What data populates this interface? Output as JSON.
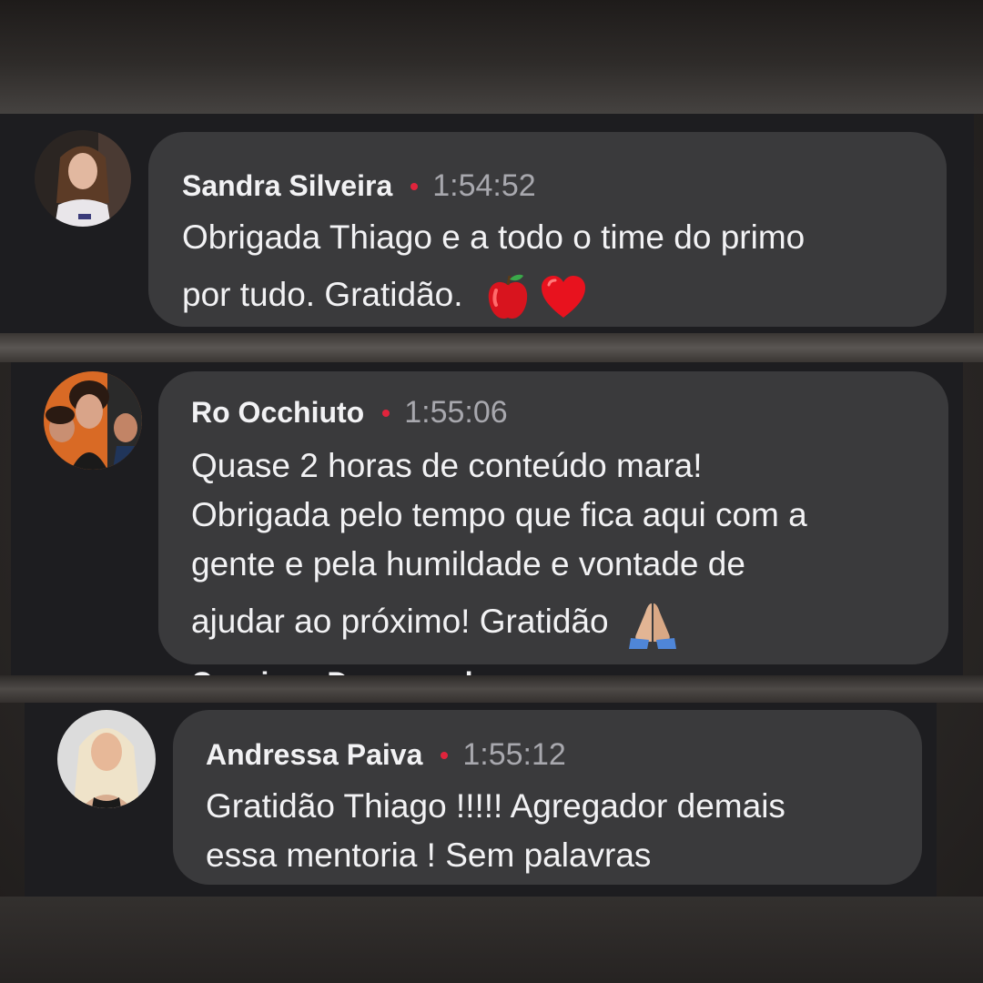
{
  "theme": {
    "dot_color": "#e0243c"
  },
  "comments": [
    {
      "name": "Sandra Silveira",
      "time": "1:54:52",
      "lines": [
        "Obrigada Thiago e a todo o time do primo",
        "por tudo. Gratidão."
      ],
      "emojis": [
        "red-apple",
        "red-heart"
      ]
    },
    {
      "name": "Ro Occhiuto",
      "time": "1:55:06",
      "lines": [
        "Quase 2 horas de conteúdo mara!",
        "Obrigada pelo tempo que fica aqui com a",
        "gente e pela humildade e vontade de",
        "ajudar ao próximo! Gratidão"
      ],
      "emojis": [
        "folded-hands"
      ]
    },
    {
      "name": "Andressa Paiva",
      "time": "1:55:12",
      "lines": [
        "Gratidão Thiago !!!!! Agregador demais",
        "essa mentoria ! Sem palavras"
      ],
      "emojis": []
    }
  ],
  "clipped_next_comment_name": "Cassiane Damasceda"
}
